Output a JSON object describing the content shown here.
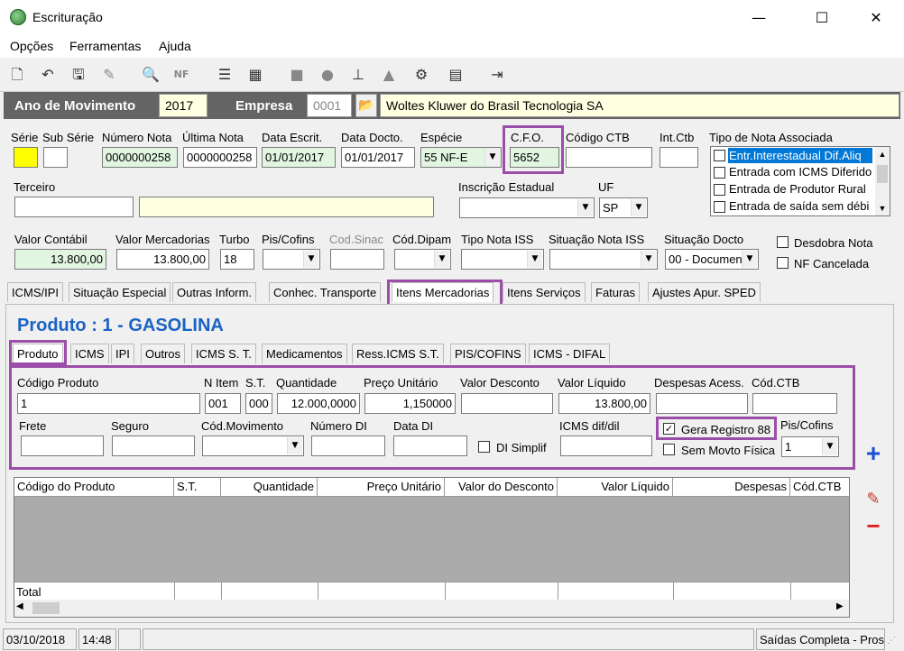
{
  "window": {
    "title": "Escrituração",
    "minimize": "—",
    "maximize": "☐",
    "close": "✕"
  },
  "menu": [
    "Opções",
    "Ferramentas",
    "Ajuda"
  ],
  "header": {
    "ano_label": "Ano de Movimento",
    "ano_value": "2017",
    "empresa_label": "Empresa",
    "empresa_code": "0001",
    "empresa_name": "Woltes Kluwer do Brasil Tecnologia SA"
  },
  "nota": {
    "serie_label": "Série",
    "sub_serie_label": "Sub Série",
    "numero_label": "Número Nota",
    "numero_value": "0000000258",
    "ultima_label": "Última Nota",
    "ultima_value": "0000000258",
    "data_escrit_label": "Data Escrit.",
    "data_escrit_value": "01/01/2017",
    "data_docto_label": "Data Docto.",
    "data_docto_value": "01/01/2017",
    "especie_label": "Espécie",
    "especie_value": "55  NF-E",
    "cfo_label": "C.F.O.",
    "cfo_value": "5652",
    "codigo_ctb_label": "Código CTB",
    "int_ctb_label": "Int.Ctb",
    "tipo_nota_label": "Tipo de Nota Associada",
    "tipo_nota_items": [
      "Entr.Interestadual Dif.Aliq",
      "Entrada com ICMS Diferido",
      "Entrada de Produtor Rural",
      "Entrada de saída sem débi"
    ],
    "terceiro_label": "Terceiro",
    "inscricao_label": "Inscrição Estadual",
    "uf_label": "UF",
    "uf_value": "SP",
    "valor_contabil_label": "Valor Contábil",
    "valor_contabil_value": "13.800,00",
    "valor_merc_label": "Valor Mercadorias",
    "valor_merc_value": "13.800,00",
    "turbo_label": "Turbo",
    "turbo_value": "18",
    "pis_cofins_label": "Pis/Cofins",
    "cod_sinac_label": "Cod.Sinac",
    "cod_dipam_label": "Cód.Dipam",
    "tipo_iss_label": "Tipo Nota ISS",
    "situacao_iss_label": "Situação Nota ISS",
    "situacao_docto_label": "Situação Docto",
    "situacao_docto_value": "00 - Documen",
    "desdobra_label": "Desdobra Nota",
    "nf_cancelada_label": "NF Cancelada"
  },
  "tabs": [
    "ICMS/IPI",
    "Situação Especial",
    "Outras Inform.",
    "Conhec. Transporte",
    "Itens Mercadorias",
    "Itens Serviços",
    "Faturas",
    "Ajustes Apur. SPED"
  ],
  "produto_title": "Produto : 1 - GASOLINA",
  "subtabs": [
    "Produto",
    "ICMS",
    "IPI",
    "Outros",
    "ICMS S. T.",
    "Medicamentos",
    "Ress.ICMS S.T.",
    "PIS/COFINS",
    "ICMS - DIFAL"
  ],
  "item": {
    "codigo_label": "Código Produto",
    "codigo_value": "1",
    "n_item_label": "N Item",
    "n_item_value": "001",
    "st_label": "S.T.",
    "st_value": "000",
    "quantidade_label": "Quantidade",
    "quantidade_value": "12.000,0000",
    "preco_label": "Preço Unitário",
    "preco_value": "1,150000",
    "desconto_label": "Valor Desconto",
    "liquido_label": "Valor Líquido",
    "liquido_value": "13.800,00",
    "despesas_label": "Despesas Acess.",
    "cod_ctb_label": "Cód.CTB",
    "frete_label": "Frete",
    "seguro_label": "Seguro",
    "cod_mov_label": "Cód.Movimento",
    "numero_di_label": "Número DI",
    "data_di_label": "Data DI",
    "di_simplif_label": "DI Simplif",
    "icms_dif_label": "ICMS dif/dil",
    "gera88_label": "Gera Registro 88",
    "sem_movto_label": "Sem Movto Física",
    "pis_cofins_label": "Pis/Cofins",
    "pis_cofins_value": "1"
  },
  "grid": {
    "columns": [
      "Código do Produto",
      "S.T.",
      "Quantidade",
      "Preço Unitário",
      "Valor do Desconto",
      "Valor Líquido",
      "Despesas",
      "Cód.CTB"
    ],
    "total_label": "Total"
  },
  "status": {
    "date": "03/10/2018",
    "time": "14:48",
    "right": "Saídas Completa - Pros"
  }
}
